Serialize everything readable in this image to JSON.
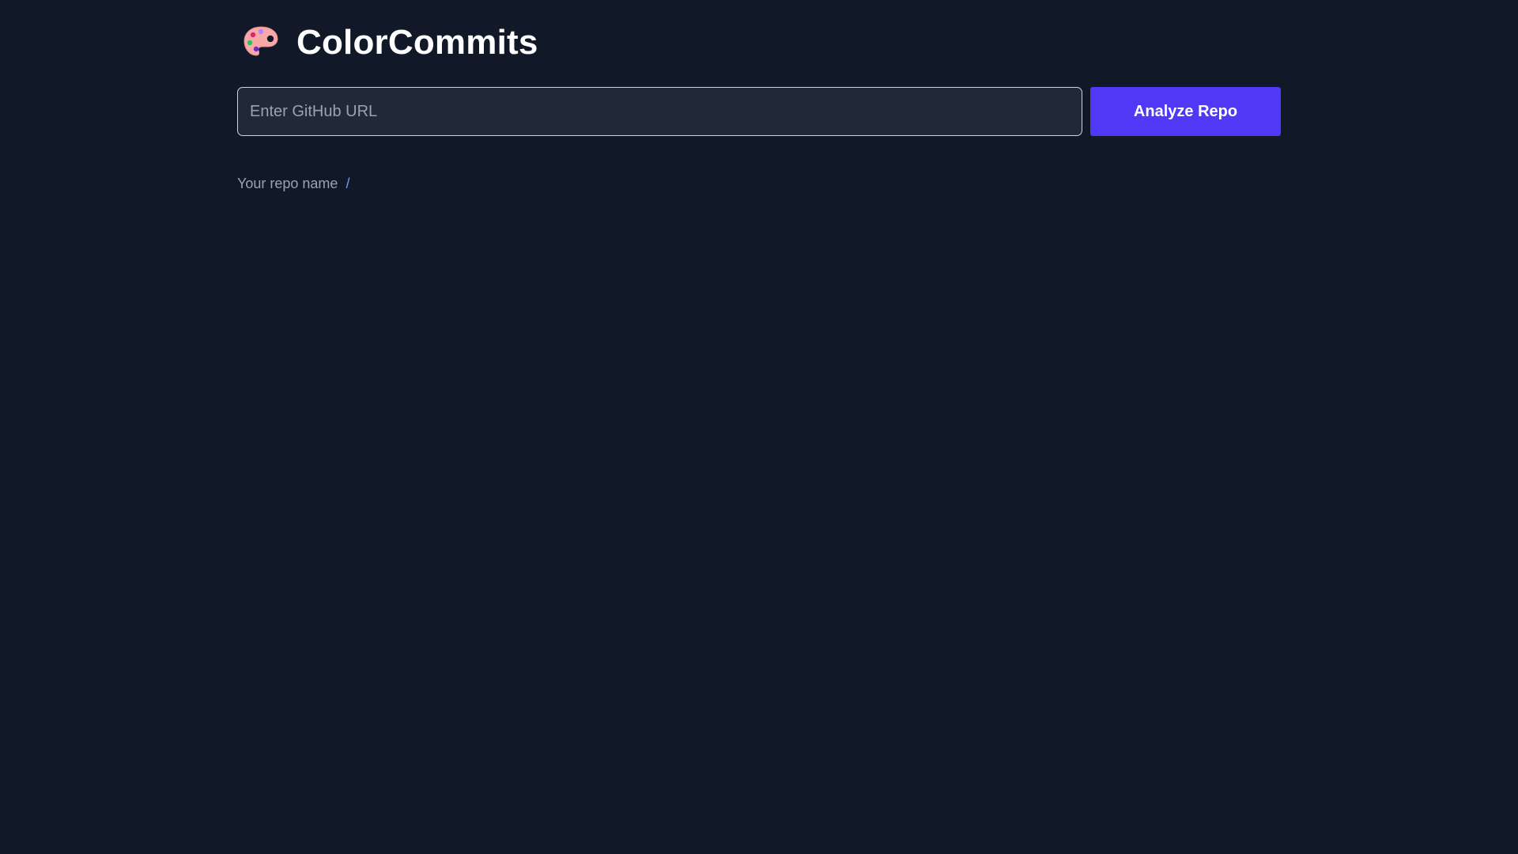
{
  "header": {
    "title": "ColorCommits",
    "logo_icon": "palette-icon"
  },
  "search": {
    "placeholder": "Enter GitHub URL",
    "value": "",
    "button_label": "Analyze Repo"
  },
  "breadcrumb": {
    "repo_label": "Your repo name",
    "separator": "/"
  },
  "colors": {
    "background": "#111827",
    "input_background": "#1f2937",
    "accent": "#4f39f6",
    "separator": "#60a5fa"
  }
}
